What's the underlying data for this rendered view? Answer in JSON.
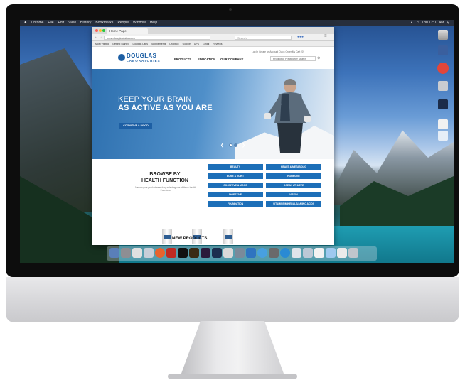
{
  "menubar": {
    "apple": "",
    "items": [
      "Chrome",
      "File",
      "Edit",
      "View",
      "History",
      "Bookmarks",
      "People",
      "Window",
      "Help"
    ],
    "right_status": "Thu 12:07 AM"
  },
  "browser": {
    "tab_title": "Home Page",
    "url": "www.douglaslabs.com",
    "search_placeholder": "Search",
    "bookmarks": [
      "Most Visited",
      "Getting Started",
      "Douglas Labs",
      "Supplements",
      "Dropbox",
      "Google",
      "UPS",
      "Gmail",
      "Reviews"
    ]
  },
  "site": {
    "logo_top": "DOUGLAS",
    "logo_bottom": "LABORATORIES",
    "nav": [
      "PRODUCTS",
      "EDUCATION",
      "OUR COMPANY"
    ],
    "util_links": "Log In   Create an Account   Quick Order   My Cart (0)",
    "search_placeholder": "Product or Practitioner Search"
  },
  "hero": {
    "line1": "KEEP YOUR BRAIN",
    "line2": "AS ACTIVE AS YOU ARE",
    "cta": "COGNITIVE & MOOD"
  },
  "browse": {
    "heading_line1": "BROWSE BY",
    "heading_line2": "HEALTH FUNCTION",
    "description": "Narrow your product search by selecting one of these Health Functions.",
    "categories_left": [
      "BEAUTY",
      "BONE & JOINT",
      "COGNITIVE & MOOD",
      "DIGESTIVE",
      "FOUNDATION"
    ],
    "categories_right": [
      "HEART & METABOLIC",
      "HORMONE",
      "OCEAN ATHLETE",
      "VISION",
      "VITAMINS/MINERALS/AMINO ACIDS"
    ]
  },
  "products": {
    "heading": "NEW PRODUCTS"
  },
  "colors": {
    "brand_blue": "#1d5fa4",
    "category_blue": "#1d6fb8"
  }
}
